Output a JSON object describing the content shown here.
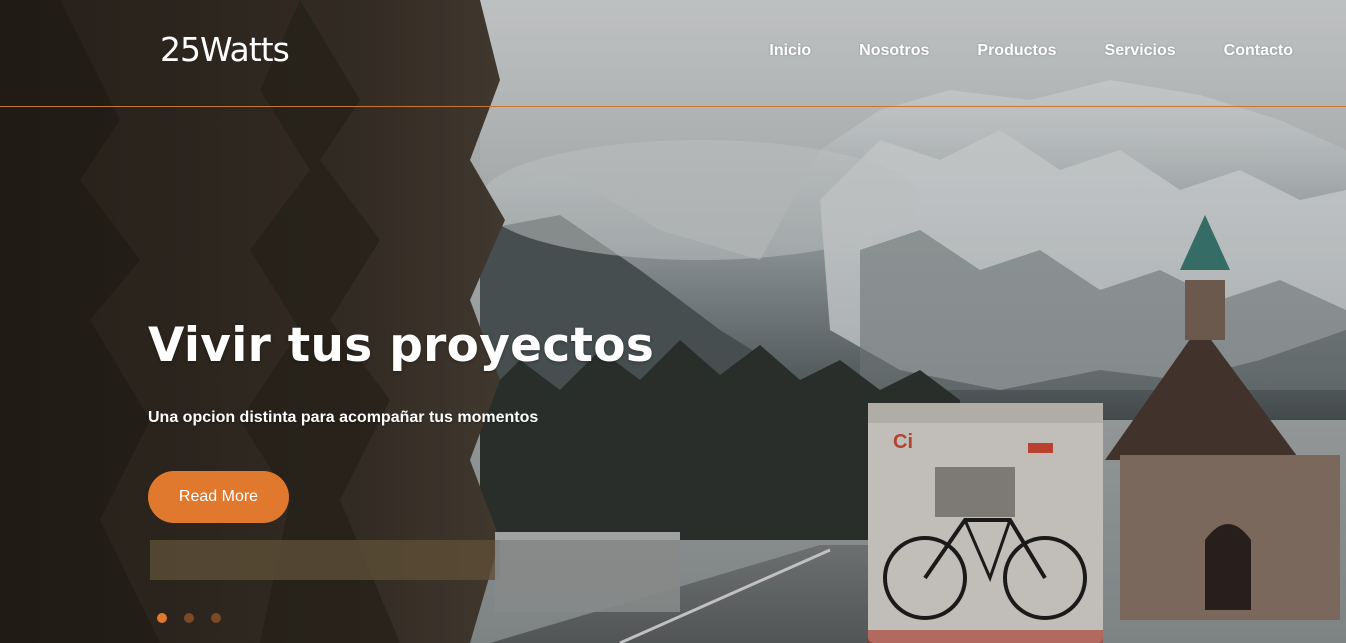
{
  "brand": {
    "logo_text": "25Watts"
  },
  "nav": {
    "items": [
      {
        "label": "Inicio"
      },
      {
        "label": "Nosotros"
      },
      {
        "label": "Productos"
      },
      {
        "label": "Servicios"
      },
      {
        "label": "Contacto"
      }
    ]
  },
  "hero": {
    "title": "Vivir tus proyectos",
    "subtitle": "Una opcion distinta para acompañar tus momentos",
    "cta_label": "Read More",
    "slider": {
      "slide_count": 3,
      "active_index": 0
    },
    "background_image": "mountain-road-campervan-photo"
  },
  "colors": {
    "accent": "#e0782e",
    "header_divider": "#c9772f",
    "text": "#ffffff"
  }
}
